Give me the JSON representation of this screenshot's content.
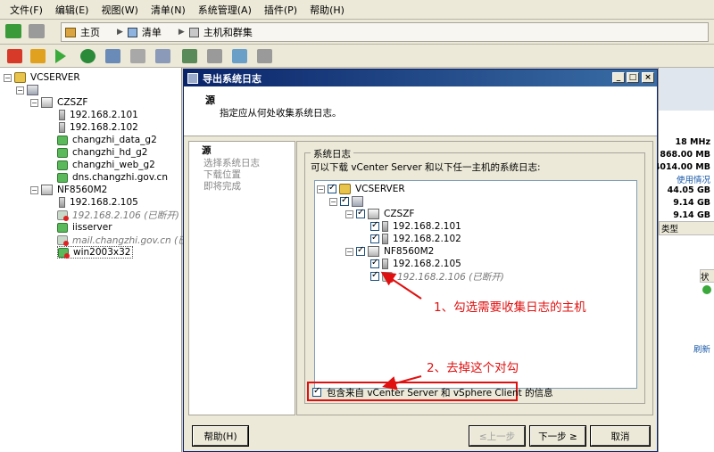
{
  "menu": [
    "文件(F)",
    "编辑(E)",
    "视图(W)",
    "清单(N)",
    "系统管理(A)",
    "插件(P)",
    "帮助(H)"
  ],
  "breadcrumbs": [
    "主页",
    "清单",
    "主机和群集"
  ],
  "tree": {
    "root": "VCSERVER",
    "cluster1": "CZSZF",
    "c1_items": [
      "192.168.2.101",
      "192.168.2.102",
      "changzhi_data_g2",
      "changzhi_hd_g2",
      "changzhi_web_g2",
      "dns.changzhi.gov.cn"
    ],
    "cluster2": "NF8560M2",
    "c2_items": [
      "192.168.2.105",
      "192.168.2.106 (已断开)",
      "iisserver",
      "mail.changzhi.gov.cn (已断)",
      "win2003x32"
    ]
  },
  "right_pane": [
    "18 MHz",
    "868.00 MB",
    "4014.00 MB",
    "使用情况",
    "44.05 GB",
    "9.14 GB",
    "9.14 GB",
    "类型",
    "状",
    "刷新"
  ],
  "dialog": {
    "title": "导出系统日志",
    "header_title": "源",
    "header_desc": "指定应从何处收集系统日志。",
    "steps": [
      "源",
      "选择系统日志",
      "下载位置",
      "即将完成"
    ],
    "group_label": "系统日志",
    "group_desc": "可以下载 vCenter Server 和以下任一主机的系统日志:",
    "tree": {
      "root": "VCSERVER",
      "c1": "CZSZF",
      "c1_hosts": [
        "192.168.2.101",
        "192.168.2.102"
      ],
      "c2": "NF8560M2",
      "c2_hosts": [
        "192.168.2.105",
        "192.168.2.106 (已断开)"
      ]
    },
    "include_label": "包含来自 vCenter Server 和 vSphere Client 的信息",
    "buttons": {
      "help": "帮助(H)",
      "back": "≤上一步",
      "next": "下一步 ≥",
      "cancel": "取消"
    }
  },
  "annotations": {
    "a1": "1、勾选需要收集日志的主机",
    "a2": "2、去掉这个对勾"
  },
  "colors": {
    "titlebar": "#0a246a",
    "annotation": "#e01010"
  }
}
